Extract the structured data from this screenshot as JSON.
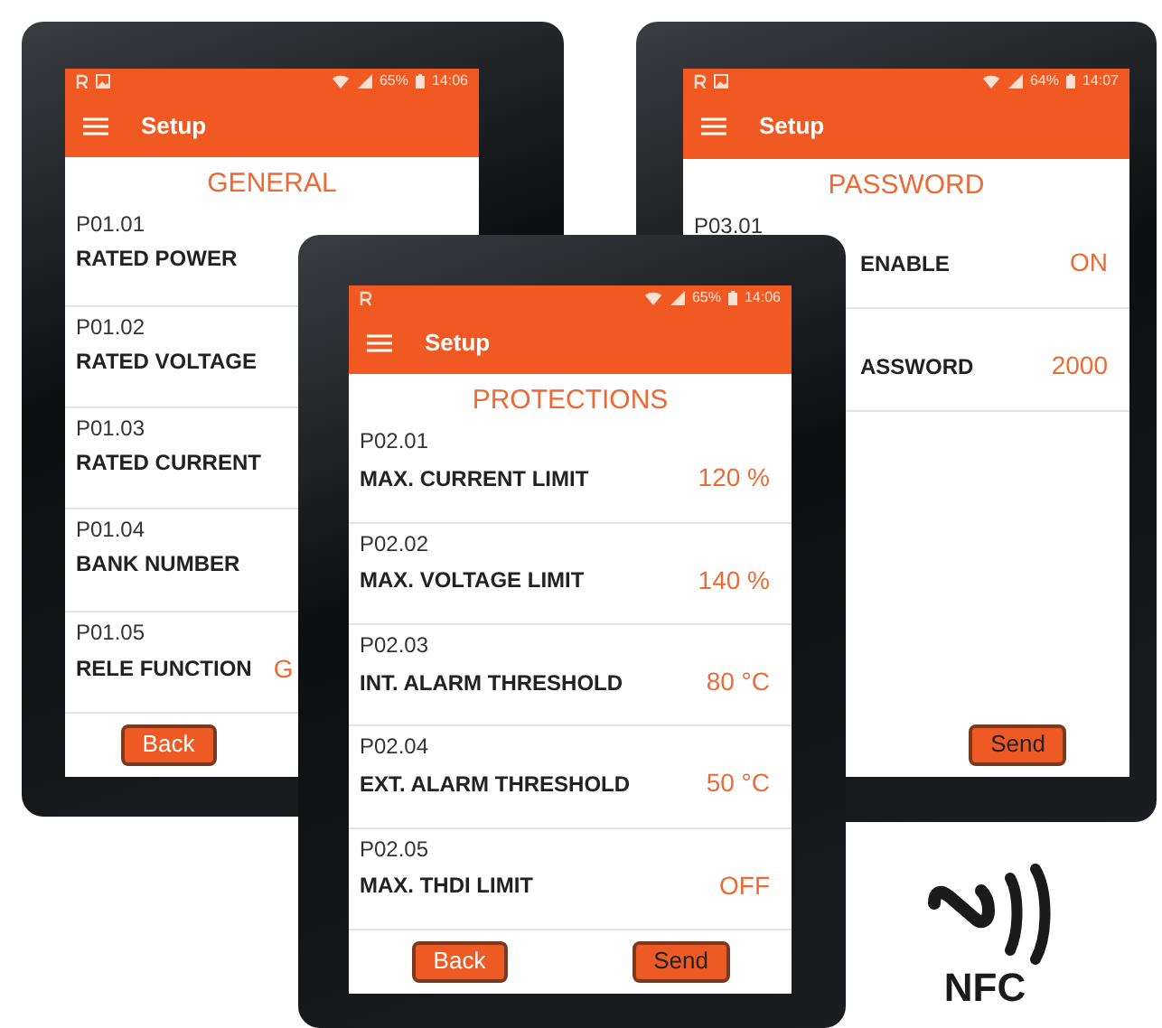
{
  "devices": [
    {
      "kind": "left",
      "status": {
        "image_notification": true,
        "battery": "65%",
        "time": "14:06"
      },
      "app_title": "Setup",
      "section": "GENERAL",
      "rows": [
        {
          "code": "P01.01",
          "label": "RATED POWER"
        },
        {
          "code": "P01.02",
          "label": "RATED VOLTAGE"
        },
        {
          "code": "P01.03",
          "label": "RATED CURRENT"
        },
        {
          "code": "P01.04",
          "label": "BANK NUMBER"
        },
        {
          "code": "P01.05",
          "label": "RELE FUNCTION",
          "value": "G"
        }
      ],
      "buttons": [
        {
          "kind": "back",
          "label": "Back"
        }
      ]
    },
    {
      "kind": "right",
      "status": {
        "image_notification": true,
        "battery": "64%",
        "time": "14:07"
      },
      "app_title": "Setup",
      "section": "PASSWORD",
      "rows": [
        {
          "code": "P03.01",
          "label": "ENABLE",
          "value": "ON"
        },
        {
          "label": "ASSWORD",
          "value": "2000"
        }
      ],
      "buttons": [
        {
          "kind": "send",
          "label": "Send"
        }
      ]
    },
    {
      "kind": "front",
      "status": {
        "image_notification": false,
        "battery": "65%",
        "time": "14:06"
      },
      "app_title": "Setup",
      "section": "PROTECTIONS",
      "rows": [
        {
          "code": "P02.01",
          "label": "MAX. CURRENT LIMIT",
          "value": "120 %"
        },
        {
          "code": "P02.02",
          "label": "MAX. VOLTAGE LIMIT",
          "value": "140 %"
        },
        {
          "code": "P02.03",
          "label": "INT. ALARM THRESHOLD",
          "value": "80 °C"
        },
        {
          "code": "P02.04",
          "label": "EXT. ALARM THRESHOLD",
          "value": "50 °C"
        },
        {
          "code": "P02.05",
          "label": "MAX. THDI LIMIT",
          "value": "OFF"
        }
      ],
      "buttons": [
        {
          "kind": "back",
          "label": "Back"
        },
        {
          "kind": "send",
          "label": "Send"
        }
      ]
    }
  ],
  "logo": {
    "text": "NFC"
  }
}
